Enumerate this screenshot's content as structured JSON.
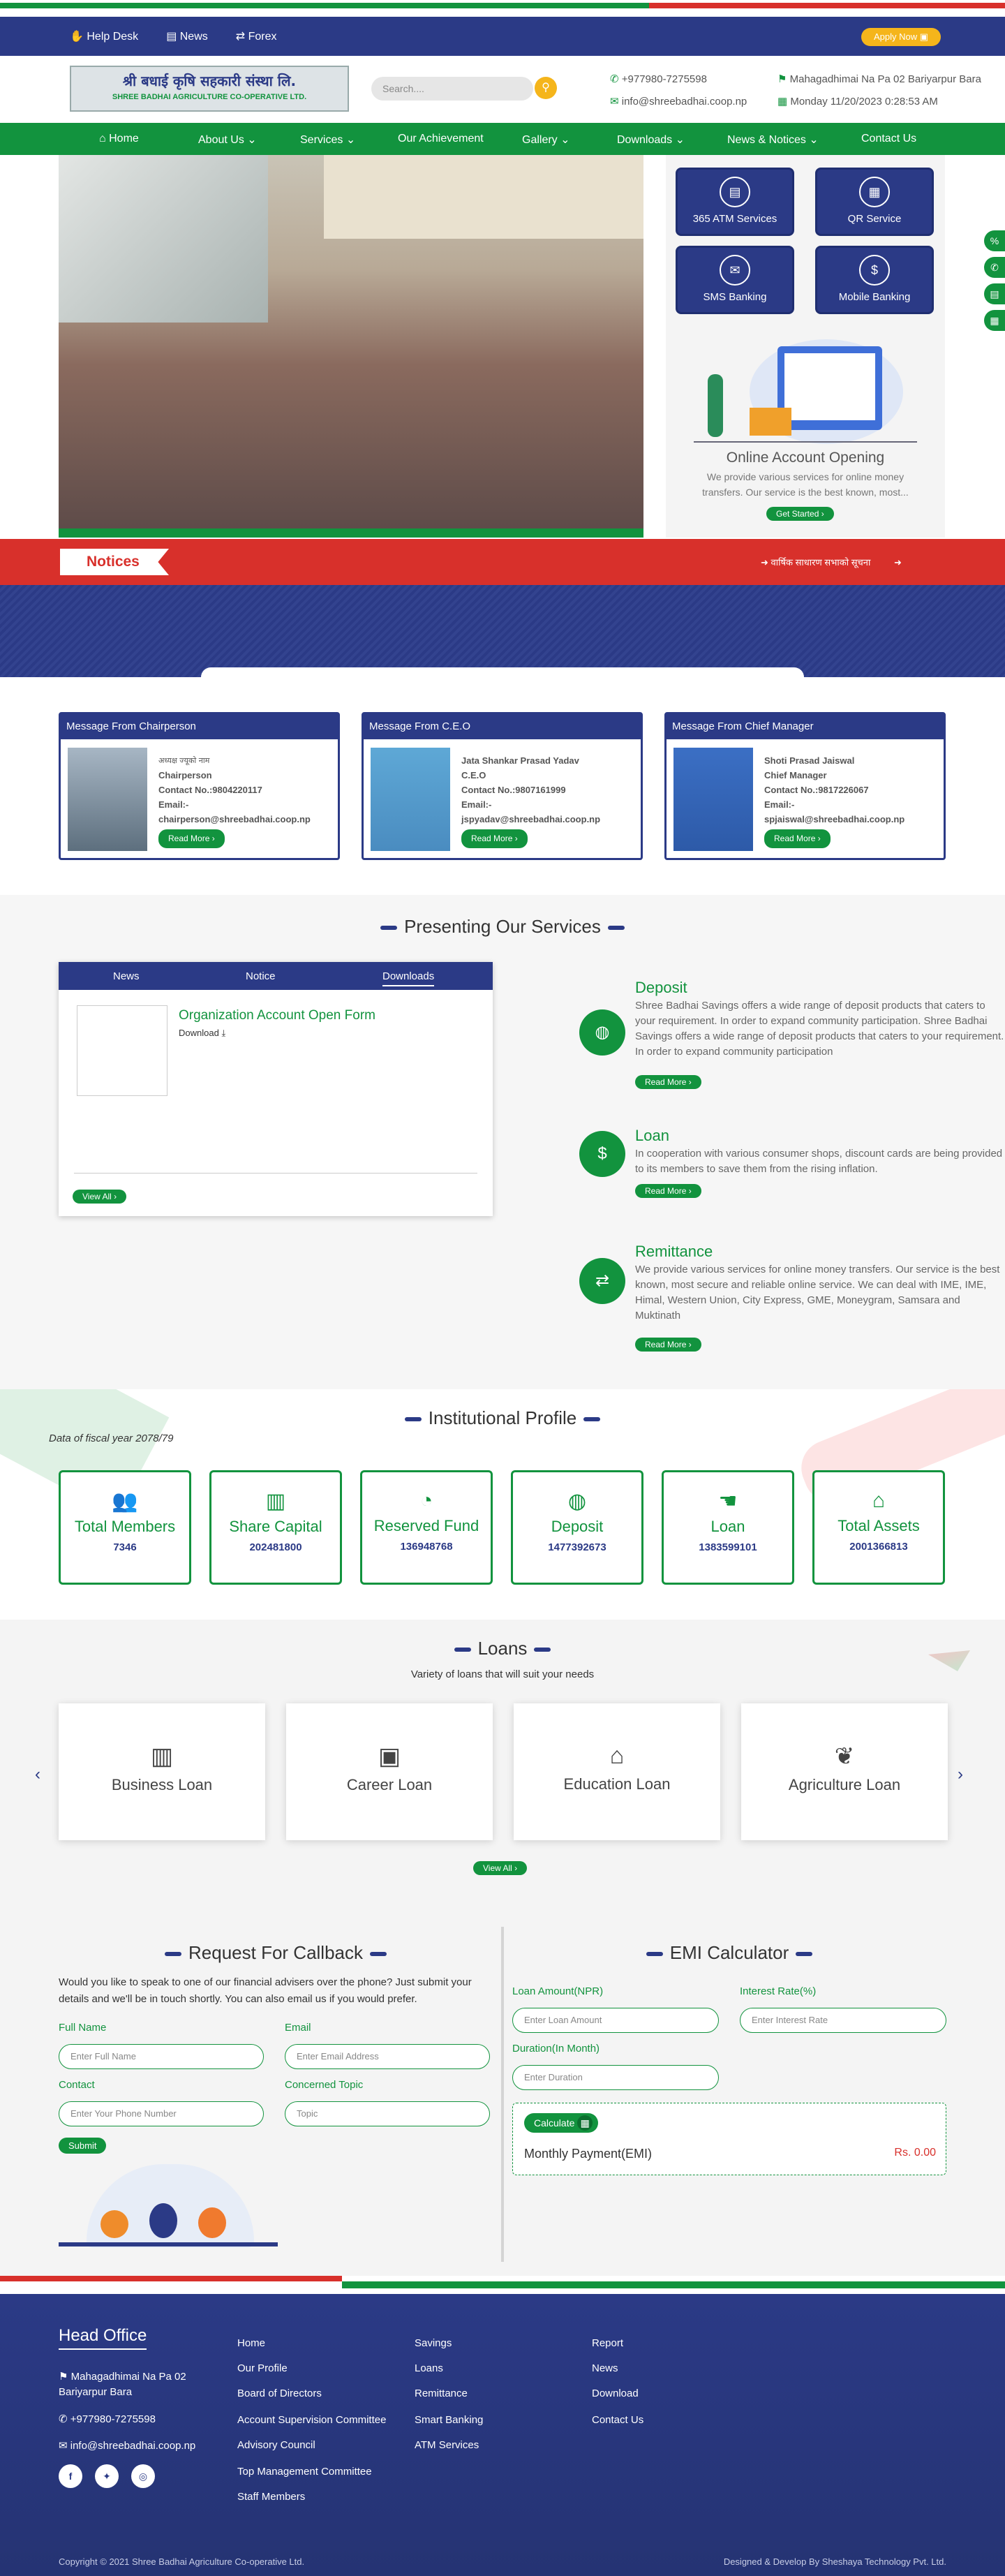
{
  "topbar": {
    "help_desk": "Help Desk",
    "news": "News",
    "forex": "Forex",
    "apply_now": "Apply Now"
  },
  "header": {
    "logo_text": "श्री बधाई कृषि सहकारी संस्था लि.",
    "logo_subtext": "SHREE BADHAI AGRICULTURE CO-OPERATIVE LTD.",
    "search_placeholder": "Search....",
    "phone": "+977980-7275598",
    "email": "info@shreebadhai.coop.np",
    "address": "Mahagadhimai Na Pa 02 Bariyarpur Bara",
    "datetime": "Monday 11/20/2023 0:28:53 AM"
  },
  "nav": {
    "home": "Home",
    "about": "About Us",
    "services": "Services",
    "achievement": "Our Achievement",
    "gallery": "Gallery",
    "downloads": "Downloads",
    "news_notices": "News & Notices",
    "contact": "Contact Us"
  },
  "service_tiles": [
    "365 ATM Services",
    "QR Service",
    "SMS Banking",
    "Mobile Banking"
  ],
  "online_account": {
    "title": "Online Account Opening",
    "desc": "We provide various services for online money transfers. Our service is the best known, most...",
    "button": "Get Started"
  },
  "notices": {
    "label": "Notices",
    "ticker": "वार्षिक साधारण सभाको सूचना"
  },
  "messages": [
    {
      "header": "Message From Chairperson",
      "name": "अध्यक्ष ज्यूको नाम",
      "role": "Chairperson",
      "contact": "Contact No.:9804220117",
      "email_label": "Email:-",
      "email": "chairperson@shreebadhai.coop.np",
      "button": "Read More"
    },
    {
      "header": "Message From C.E.O",
      "name": "Jata Shankar Prasad Yadav",
      "role": "C.E.O",
      "contact": "Contact No.:9807161999",
      "email_label": "Email:-",
      "email": "jspyadav@shreebadhai.coop.np",
      "button": "Read More"
    },
    {
      "header": "Message From Chief Manager",
      "name": "Shoti Prasad Jaiswal",
      "role": "Chief Manager",
      "contact": "Contact No.:9817226067",
      "email_label": "Email:-",
      "email": "spjaiswal@shreebadhai.coop.np",
      "button": "Read More"
    }
  ],
  "services_section": {
    "title": "Presenting Our Services",
    "tabs": [
      "News",
      "Notice",
      "Downloads"
    ],
    "download_title": "Organization Account Open Form",
    "download_link": "Download",
    "view_all": "View All",
    "items": [
      {
        "title": "Deposit",
        "desc": "Shree Badhai Savings offers a wide range of deposit products that caters to your requirement. In order to expand community participation. Shree Badhai Savings offers a wide range of deposit products that caters to your requirement. In order to expand community participation",
        "button": "Read More"
      },
      {
        "title": "Loan",
        "desc": "In cooperation with various consumer shops, discount cards are being provided to its members to save them from the rising inflation.",
        "button": "Read More"
      },
      {
        "title": "Remittance",
        "desc": "We provide various services for online money transfers. Our service is the best known, most secure and reliable online service. We can deal with IME, IME, Himal, Western Union, City Express, GME, Moneygram, Samsara and Muktinath",
        "button": "Read More"
      }
    ]
  },
  "profile": {
    "title": "Institutional Profile",
    "fiscal_note": "Data of fiscal year 2078/79",
    "cards": [
      {
        "label": "Total Members",
        "value": "7346",
        "icon": "users-icon"
      },
      {
        "label": "Share Capital",
        "value": "202481800",
        "icon": "building-icon"
      },
      {
        "label": "Reserved Fund",
        "value": "136948768",
        "icon": "pie-chart-icon"
      },
      {
        "label": "Deposit",
        "value": "1477392673",
        "icon": "piggy-bank-icon"
      },
      {
        "label": "Loan",
        "value": "1383599101",
        "icon": "hand-money-icon"
      },
      {
        "label": "Total Assets",
        "value": "2001366813",
        "icon": "bank-icon"
      }
    ]
  },
  "loans": {
    "title": "Loans",
    "subtitle": "Variety of loans that will suit your needs",
    "items": [
      "Business Loan",
      "Career Loan",
      "Education Loan",
      "Agriculture Loan"
    ],
    "view_all": "View All"
  },
  "callback": {
    "title": "Request For Callback",
    "desc": "Would you like to speak to one of our financial advisers over the phone? Just submit your details and we'll be in touch shortly. You can also email us if you would prefer.",
    "full_name_label": "Full Name",
    "full_name_ph": "Enter Full Name",
    "email_label": "Email",
    "email_ph": "Enter Email Address",
    "contact_label": "Contact",
    "contact_ph": "Enter Your Phone Number",
    "topic_label": "Concerned Topic",
    "topic_ph": "Topic",
    "submit": "Submit"
  },
  "emi": {
    "title": "EMI Calculator",
    "amount_label": "Loan Amount(NPR)",
    "amount_ph": "Enter Loan Amount",
    "rate_label": "Interest Rate(%)",
    "rate_ph": "Enter Interest Rate",
    "duration_label": "Duration(In Month)",
    "duration_ph": "Enter Duration",
    "calculate": "Calculate",
    "monthly_label": "Monthly Payment(EMI)",
    "monthly_value": "Rs. 0.00"
  },
  "footer": {
    "head_office": "Head Office",
    "address": "Mahagadhimai Na Pa 02 Bariyarpur Bara",
    "phone": "+977980-7275598",
    "email": "info@shreebadhai.coop.np",
    "col1": [
      "Home",
      "Our Profile",
      "Board of Directors",
      "Account Supervision Committee",
      "Advisory Council",
      "Top Management Committee",
      "Staff Members"
    ],
    "col2": [
      "Savings",
      "Loans",
      "Remittance",
      "Smart Banking",
      "ATM Services"
    ],
    "col3": [
      "Report",
      "News",
      "Download",
      "Contact Us"
    ],
    "copyright": "Copyright © 2021 Shree Badhai Agriculture Co-operative Ltd.",
    "developer": "Designed & Develop By Sheshaya Technology Pvt. Ltd."
  },
  "colors": {
    "primary": "#2b3a86",
    "accent": "#12933e",
    "alert": "#d8302b",
    "apply": "#f5b51b"
  }
}
